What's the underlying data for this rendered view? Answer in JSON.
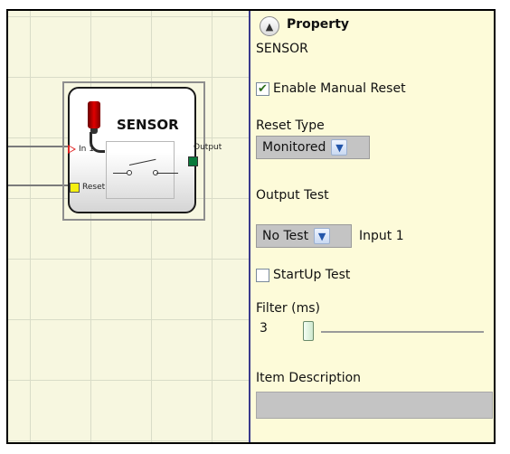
{
  "block": {
    "title": "SENSOR",
    "input_label": "In 1",
    "reset_label": "Reset",
    "output_label": "Output",
    "input_port_color": "#e02020",
    "reset_port_color": "#f5f010",
    "output_port_color": "#0a7a3a"
  },
  "panel": {
    "title": "Property",
    "component_name": "SENSOR",
    "enable_manual_reset": {
      "label": "Enable Manual Reset",
      "checked": true
    },
    "reset_type": {
      "label": "Reset Type",
      "value": "Monitored"
    },
    "output_test": {
      "label": "Output Test",
      "value": "No Test",
      "input_label": "Input 1"
    },
    "startup_test": {
      "label": "StartUp Test",
      "checked": false
    },
    "filter": {
      "label": "Filter (ms)",
      "value": "3"
    },
    "item_description": {
      "label": "Item Description",
      "value": ""
    }
  },
  "icons": {
    "collapse": "chevron-up-icon",
    "dropdown": "chevron-down-icon",
    "check": "checkmark-icon"
  },
  "colors": {
    "canvas_bg": "#f7f7e0",
    "panel_bg": "#fdfbd9",
    "divider": "#3a3a8c"
  }
}
